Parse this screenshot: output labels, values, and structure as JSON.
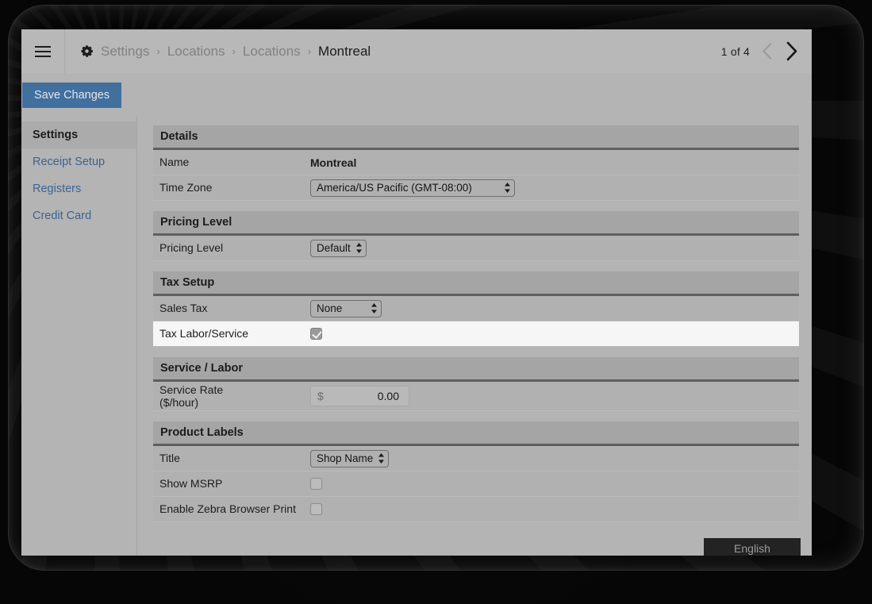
{
  "window": {
    "menu_icon": "hamburger-icon",
    "settings_icon": "gear-icon"
  },
  "header": {
    "breadcrumb": [
      {
        "label": "Settings",
        "current": false
      },
      {
        "label": "Locations",
        "current": false
      },
      {
        "label": "Locations",
        "current": false
      },
      {
        "label": "Montreal",
        "current": true
      }
    ],
    "separator": "›",
    "pager": {
      "count_label": "1 of 4",
      "prev_icon": "chevron-left-icon",
      "prev_enabled": false,
      "next_icon": "chevron-right-icon",
      "next_enabled": true
    }
  },
  "toolbar": {
    "save_label": "Save Changes",
    "save_color": "#416f9e"
  },
  "sidebar": {
    "items": [
      {
        "label": "Settings",
        "active": true
      },
      {
        "label": "Receipt Setup",
        "active": false
      },
      {
        "label": "Registers",
        "active": false
      },
      {
        "label": "Credit Card",
        "active": false
      }
    ],
    "link_color": "#3c6394"
  },
  "sections": {
    "details": {
      "title": "Details",
      "name_label": "Name",
      "name_value": "Montreal",
      "timezone_label": "Time Zone",
      "timezone_value": "America/US Pacific (GMT-08:00)"
    },
    "pricing": {
      "title": "Pricing Level",
      "level_label": "Pricing Level",
      "level_value": "Default"
    },
    "tax": {
      "title": "Tax Setup",
      "sales_tax_label": "Sales Tax",
      "sales_tax_value": "None",
      "tax_labor_label": "Tax Labor/Service",
      "tax_labor_checked": true
    },
    "service": {
      "title": "Service / Labor",
      "rate_label": "Service Rate",
      "rate_sublabel": "($/hour)",
      "currency": "$",
      "rate_value": "0.00"
    },
    "labels": {
      "title": "Product Labels",
      "title_label": "Title",
      "title_value": "Shop Name",
      "msrp_label": "Show MSRP",
      "msrp_checked": false,
      "zebra_label": "Enable Zebra Browser Print",
      "zebra_checked": false
    }
  },
  "footer": {
    "language_label": "English"
  }
}
